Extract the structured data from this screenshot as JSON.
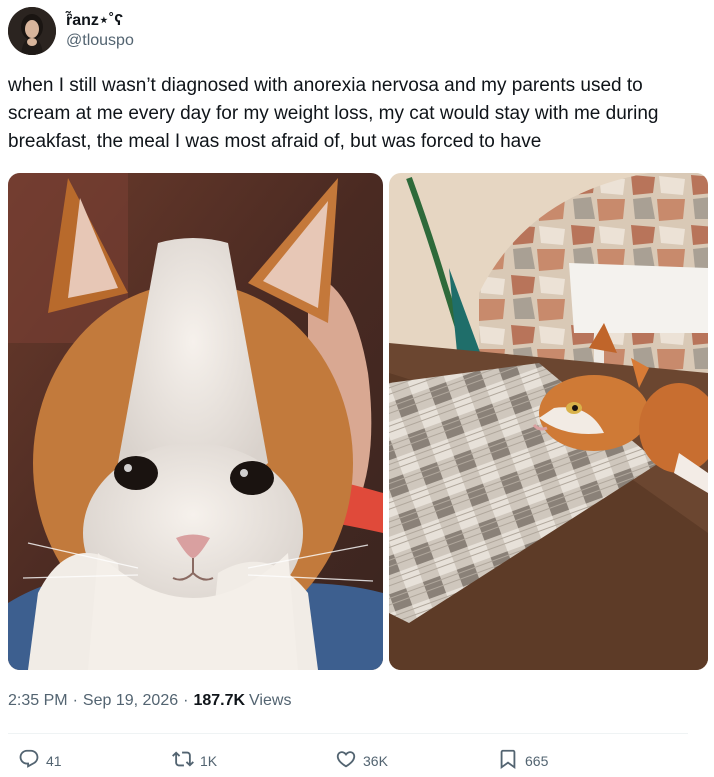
{
  "author": {
    "display_name": "ȓ̃anz⋆˚ʕ",
    "handle": "@tlouspo"
  },
  "tweet": {
    "text": "when I still wasn’t diagnosed with anorexia nervosa and my parents used to scream at me every day for my weight loss, my cat would stay with me during breakfast, the meal I was most afraid of, but was forced to have"
  },
  "meta": {
    "time": "2:35 PM",
    "separator": "·",
    "date": "Sep 19, 2026",
    "views_count": "187.7K",
    "views_label": "Views"
  },
  "actions": {
    "reply_count": "41",
    "retweet_count": "1K",
    "like_count": "36K",
    "bookmark_count": "665"
  },
  "icons": {
    "reply": "reply-icon",
    "retweet": "retweet-icon",
    "like": "heart-icon",
    "bookmark": "bookmark-icon"
  },
  "colors": {
    "text_primary": "#0f1419",
    "text_secondary": "#536471",
    "divider": "#eff3f4"
  }
}
